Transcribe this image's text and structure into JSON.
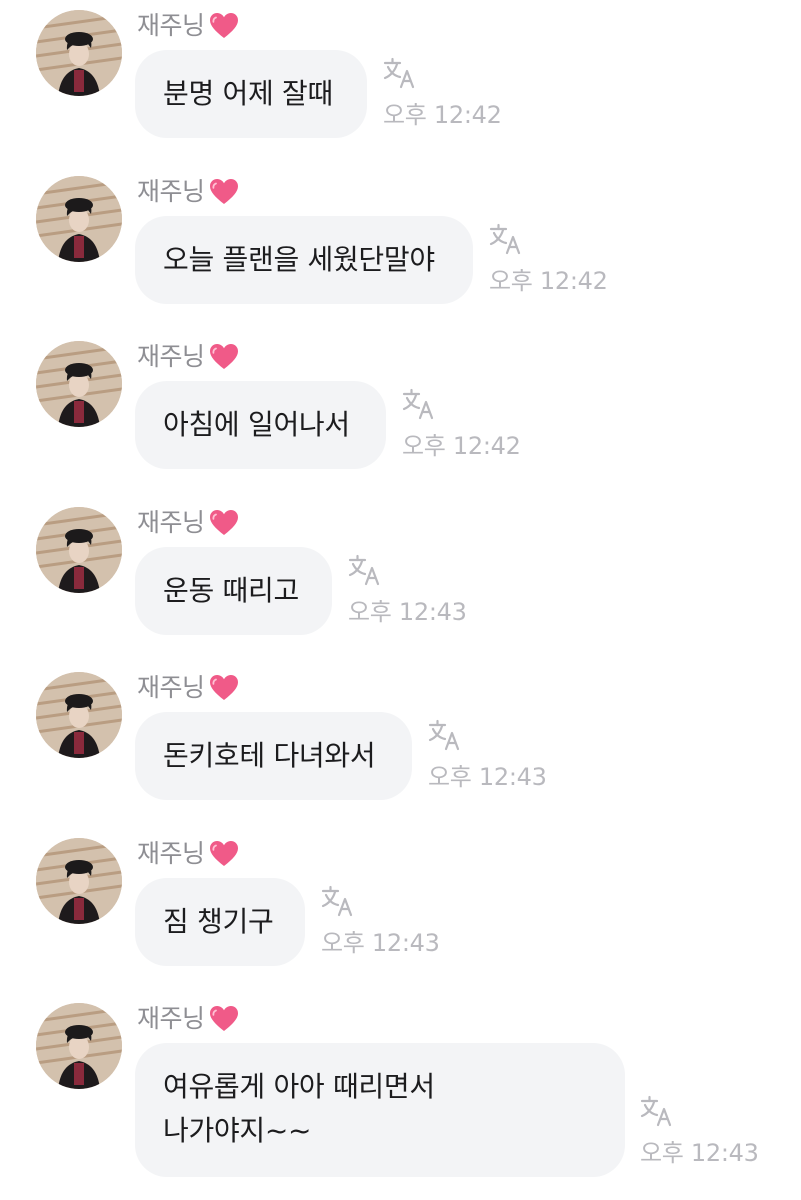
{
  "colors": {
    "bubble": "#f3f4f6",
    "name": "#8e8e93",
    "time": "#b9b9be",
    "heart": "#f05a88"
  },
  "icons": {
    "heart": "heart-icon",
    "translate": "translate-icon",
    "avatar": "profile-photo"
  },
  "messages": [
    {
      "sender": "재주닝",
      "text": "분명 어제 잘때",
      "time": "오후 12:42"
    },
    {
      "sender": "재주닝",
      "text": "오늘 플랜을 세웠단말야",
      "time": "오후 12:42"
    },
    {
      "sender": "재주닝",
      "text": "아침에 일어나서",
      "time": "오후 12:42"
    },
    {
      "sender": "재주닝",
      "text": "운동 때리고",
      "time": "오후 12:43"
    },
    {
      "sender": "재주닝",
      "text": "돈키호테 다녀와서",
      "time": "오후 12:43"
    },
    {
      "sender": "재주닝",
      "text": "짐 챙기구",
      "time": "오후 12:43"
    },
    {
      "sender": "재주닝",
      "text": "여유롭게 아아 때리면서\n나가야지~~",
      "time": "오후 12:43"
    }
  ]
}
